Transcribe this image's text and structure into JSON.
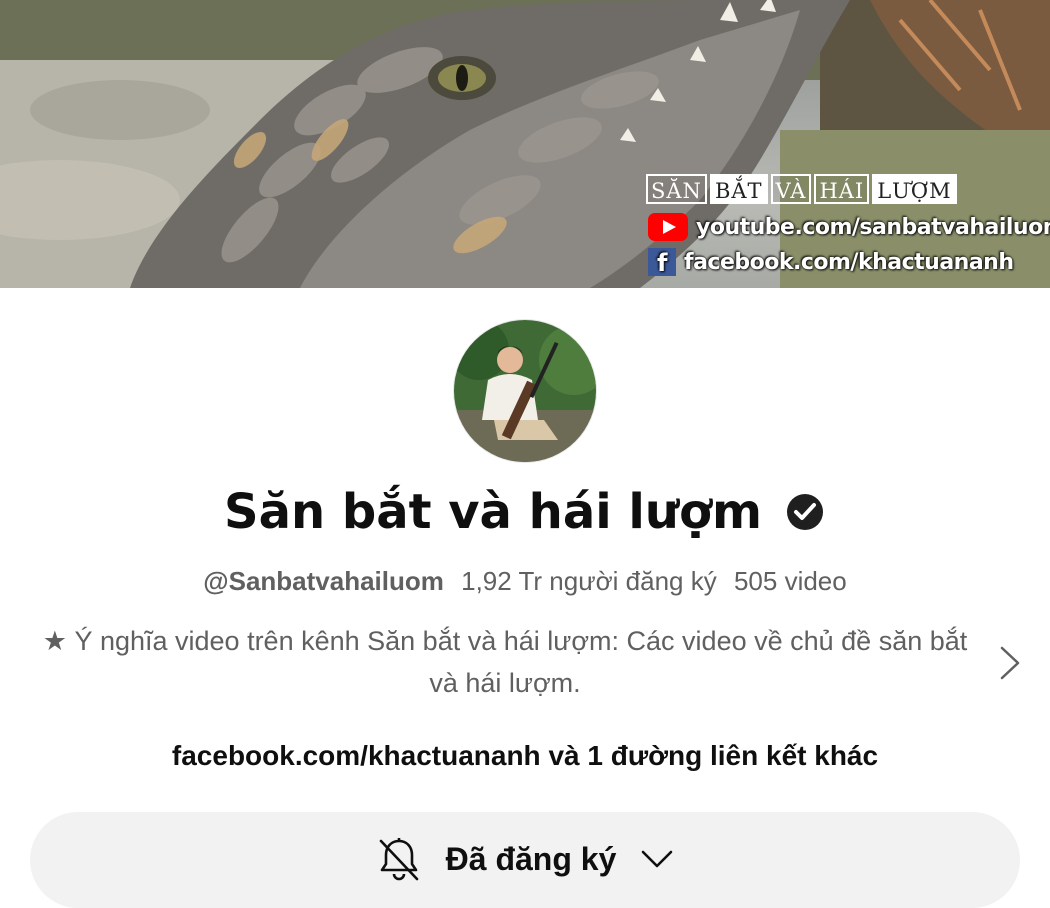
{
  "banner": {
    "brand_letters": [
      "SĂN",
      "BẮT",
      "VÀ",
      "HÁI",
      "LƯỢM"
    ],
    "youtube_text": "youtube.com/sanbatvahailuom",
    "facebook_text": "facebook.com/khactuananh",
    "youtube_icon": "youtube-icon",
    "facebook_icon": "facebook-icon"
  },
  "channel": {
    "name": "Săn bắt và hái lượm",
    "verified_icon": "verified-check-icon",
    "handle": "@Sanbatvahailuom",
    "subscribers": "1,92 Tr người đăng ký",
    "videos": "505 video",
    "description": "★ Ý nghĩa video trên kênh Săn bắt và hái lượm: Các video về chủ đề săn bắt và hái lượm.",
    "links_text": "facebook.com/khactuananh và 1 đường liên kết khác"
  },
  "subscribe_button": {
    "label": "Đã đăng ký",
    "bell_icon": "bell-off-icon",
    "chevron_icon": "chevron-down-icon"
  },
  "colors": {
    "text_primary": "#0f0f0f",
    "text_secondary": "#606060",
    "button_bg": "#f2f2f2",
    "youtube_red": "#ff0000",
    "facebook_blue": "#3b5998"
  }
}
